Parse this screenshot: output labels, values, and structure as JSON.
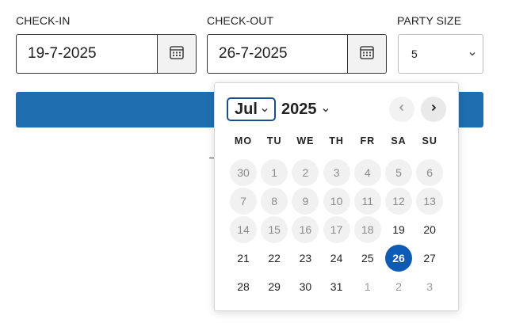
{
  "form": {
    "checkin": {
      "label": "CHECK-IN",
      "value": "19-7-2025"
    },
    "checkout": {
      "label": "CHECK-OUT",
      "value": "26-7-2025"
    },
    "party_size": {
      "label": "PARTY SIZE",
      "value": "5"
    }
  },
  "calendar": {
    "month": "Jul",
    "year": "2025",
    "weekdays": [
      "MO",
      "TU",
      "WE",
      "TH",
      "FR",
      "SA",
      "SU"
    ],
    "weeks": [
      [
        {
          "label": "30",
          "state": "disabled"
        },
        {
          "label": "1",
          "state": "disabled"
        },
        {
          "label": "2",
          "state": "disabled"
        },
        {
          "label": "3",
          "state": "disabled"
        },
        {
          "label": "4",
          "state": "disabled"
        },
        {
          "label": "5",
          "state": "disabled"
        },
        {
          "label": "6",
          "state": "disabled"
        }
      ],
      [
        {
          "label": "7",
          "state": "disabled"
        },
        {
          "label": "8",
          "state": "disabled"
        },
        {
          "label": "9",
          "state": "disabled"
        },
        {
          "label": "10",
          "state": "disabled"
        },
        {
          "label": "11",
          "state": "disabled"
        },
        {
          "label": "12",
          "state": "disabled"
        },
        {
          "label": "13",
          "state": "disabled"
        }
      ],
      [
        {
          "label": "14",
          "state": "disabled"
        },
        {
          "label": "15",
          "state": "disabled"
        },
        {
          "label": "16",
          "state": "disabled"
        },
        {
          "label": "17",
          "state": "disabled"
        },
        {
          "label": "18",
          "state": "disabled"
        },
        {
          "label": "19",
          "state": "normal"
        },
        {
          "label": "20",
          "state": "normal"
        }
      ],
      [
        {
          "label": "21",
          "state": "normal"
        },
        {
          "label": "22",
          "state": "normal"
        },
        {
          "label": "23",
          "state": "normal"
        },
        {
          "label": "24",
          "state": "normal"
        },
        {
          "label": "25",
          "state": "normal"
        },
        {
          "label": "26",
          "state": "selected"
        },
        {
          "label": "27",
          "state": "normal"
        }
      ],
      [
        {
          "label": "28",
          "state": "normal"
        },
        {
          "label": "29",
          "state": "normal"
        },
        {
          "label": "30",
          "state": "normal"
        },
        {
          "label": "31",
          "state": "normal"
        },
        {
          "label": "1",
          "state": "other"
        },
        {
          "label": "2",
          "state": "other"
        },
        {
          "label": "3",
          "state": "other"
        }
      ]
    ]
  },
  "colors": {
    "primary": "#1f6fb0",
    "selected_day": "#0e5bb5"
  },
  "icons": {
    "date_picker": "calendar-icon",
    "dropdown": "chevron-down-icon",
    "prev": "chevron-left-icon",
    "next": "chevron-right-icon"
  }
}
